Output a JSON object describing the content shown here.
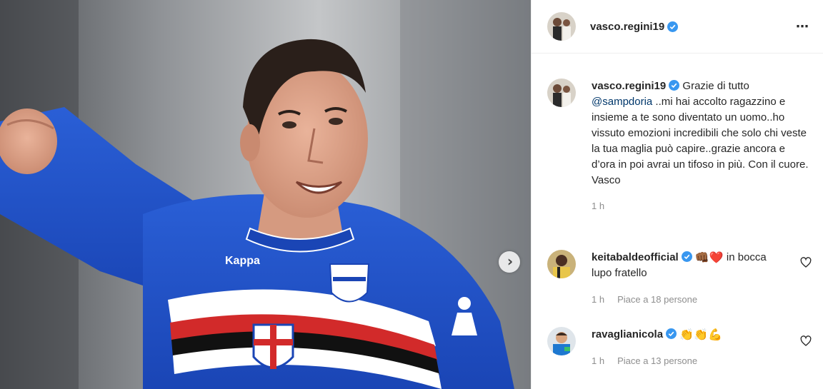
{
  "post": {
    "author": "vasco.regini19",
    "more_icon": "⋯",
    "next_icon": "›"
  },
  "caption": {
    "username": "vasco.regini19",
    "text_before": "Grazie di tutto ",
    "mention": "@sampdoria",
    "text_after": " ..mi hai accolto ragazzino e insieme a te sono diventato un uomo..ho vissuto emozioni incredibili che solo chi veste la tua maglia può capire..grazie ancora e d’ora in poi avrai un tifoso in più. Con il cuore. Vasco",
    "time": "1 h"
  },
  "comments": [
    {
      "username": "keitabaldeofficial",
      "emojis": "👊🏾❤️",
      "text": " in bocca lupo fratello",
      "time": "1 h",
      "likes": "Piace a 18 persone"
    },
    {
      "username": "ravaglianicola",
      "emojis": "👏👏💪",
      "text": "",
      "time": "1 h",
      "likes": "Piace a 13 persone"
    }
  ],
  "jersey_text": {
    "brand": "Kappa"
  },
  "colors": {
    "verified": "#3897f0",
    "mention": "#00376b",
    "meta": "#8e8e8e",
    "jersey_blue": "#1f4fc8"
  }
}
